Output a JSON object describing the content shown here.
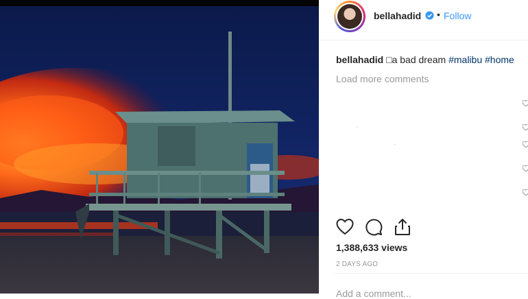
{
  "post": {
    "username": "bellahadid",
    "verified": true,
    "follow_label": "Follow",
    "separator": "•",
    "caption_user": "bellahadid",
    "caption_text": " □a bad dream ",
    "hashtags": [
      "#malibu",
      "#home"
    ],
    "load_more": "Load more comments",
    "views": "1,388,633 views",
    "age": "2 DAYS AGO",
    "add_comment_placeholder": "Add a comment..."
  },
  "icons": {
    "like": "heart-outline-icon",
    "comment": "comment-bubble-icon",
    "share": "share-upload-icon",
    "verified": "verified-badge-icon"
  },
  "colors": {
    "accent": "#3897f0",
    "hashtag": "#003569",
    "muted": "#999999",
    "text": "#262626"
  }
}
